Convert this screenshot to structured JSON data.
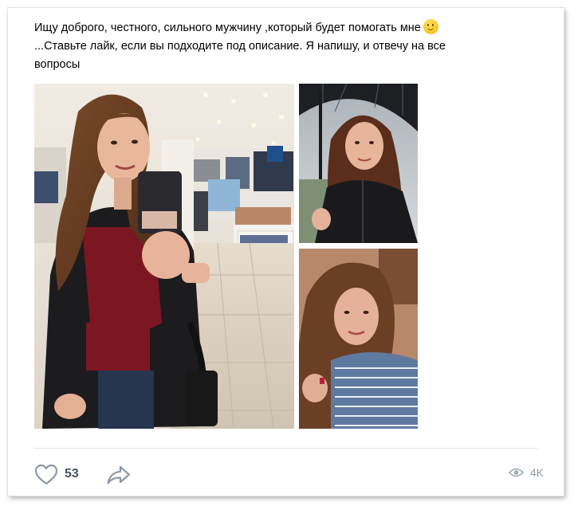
{
  "post": {
    "text_line1": "Ищу доброго, честного, сильного мужчину ,который будет помогать мне",
    "text_line2": "...Ставьте лайк, если вы подходите под описание. Я напишу, и отвечу на все",
    "text_line3": "вопросы",
    "emoji": "smiling-face-emoji",
    "photos": [
      {
        "name": "mirror-selfie-in-store"
      },
      {
        "name": "selfie-with-umbrella"
      },
      {
        "name": "selfie-with-hand-on-shoulder"
      }
    ]
  },
  "footer": {
    "likes": "53",
    "views": "4K",
    "like_icon": "heart-icon",
    "share_icon": "share-arrow-icon",
    "views_icon": "eye-icon"
  },
  "colors": {
    "icon_gray": "#8e99a6",
    "text": "#000000",
    "counter_gray": "#939aa3",
    "divider": "#e7e8ec"
  }
}
